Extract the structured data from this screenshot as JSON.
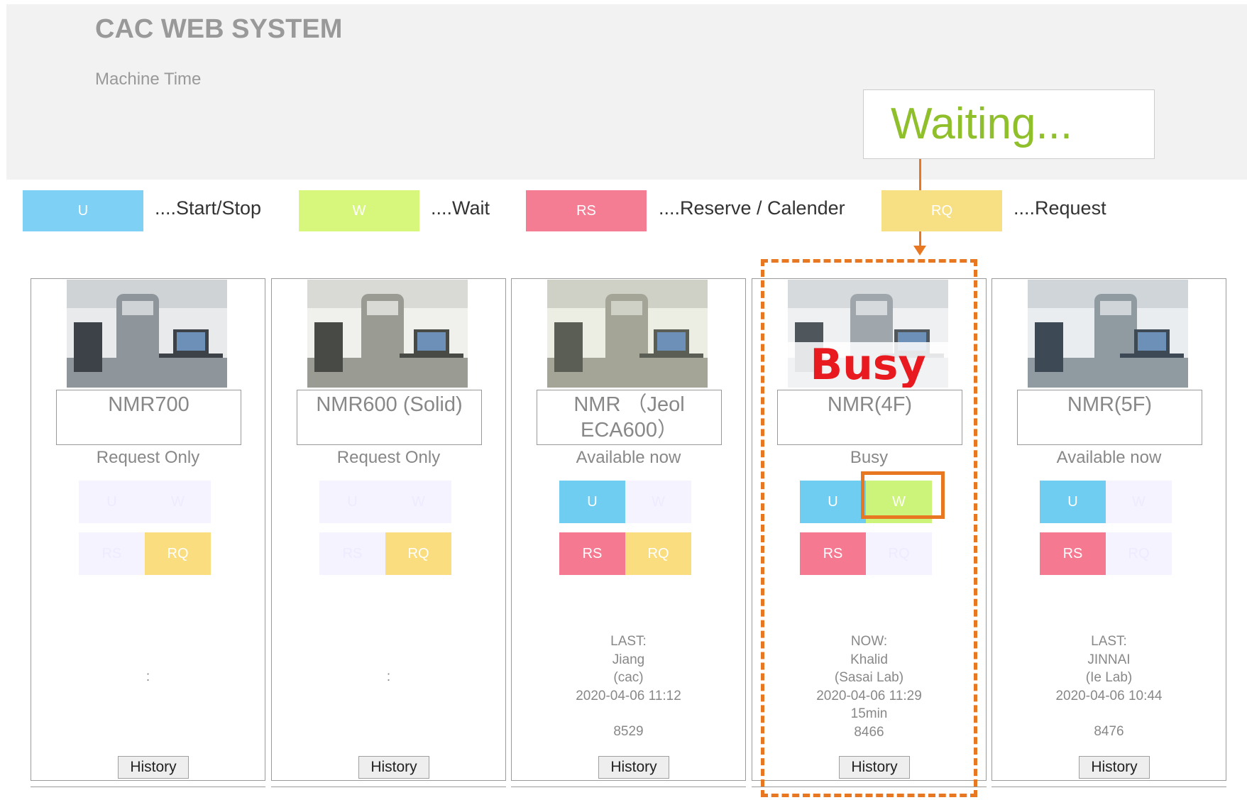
{
  "header": {
    "title": "CAC WEB SYSTEM",
    "subtitle": "Machine Time",
    "callout": "Waiting..."
  },
  "legend": [
    {
      "code": "U",
      "label": "....Start/Stop",
      "color": "#7ed0f4"
    },
    {
      "code": "W",
      "label": "....Wait",
      "color": "#d6f77c"
    },
    {
      "code": "RS",
      "label": "....Reserve / Calender",
      "color": "#f47c93"
    },
    {
      "code": "RQ",
      "label": "....Request",
      "color": "#f7df84"
    }
  ],
  "colors": {
    "u": "#6fcdf1",
    "w": "#ccf47a",
    "rs": "#f57a91",
    "rq": "#f9dd7e",
    "inactive": "#f5f3ff",
    "highlight": "#e87722"
  },
  "buttons": {
    "u": "U",
    "w": "W",
    "rs": "RS",
    "rq": "RQ"
  },
  "history_label": "History",
  "machines": [
    {
      "name": "NMR700",
      "status": "Request Only",
      "active": {
        "u": false,
        "w": false,
        "rs": false,
        "rq": true
      },
      "info": [
        "",
        "",
        ":",
        "",
        "",
        ""
      ]
    },
    {
      "name": "NMR600 (Solid)",
      "status": "Request Only",
      "active": {
        "u": false,
        "w": false,
        "rs": false,
        "rq": true
      },
      "info": [
        "",
        "",
        ":",
        "",
        "",
        ""
      ]
    },
    {
      "name": "NMR （Jeol ECA600）",
      "status": "Available now",
      "active": {
        "u": true,
        "w": false,
        "rs": true,
        "rq": true
      },
      "info": [
        "LAST:",
        "Jiang",
        "(cac)",
        "2020-04-06 11:12",
        "",
        "8529"
      ]
    },
    {
      "name": "NMR(4F)",
      "status": "Busy",
      "overlay": "Busy",
      "active": {
        "u": true,
        "w": true,
        "rs": true,
        "rq": false
      },
      "info": [
        "NOW:",
        "Khalid",
        "(Sasai Lab)",
        "2020-04-06 11:29",
        "15min",
        "8466"
      ]
    },
    {
      "name": "NMR(5F)",
      "status": "Available now",
      "active": {
        "u": true,
        "w": false,
        "rs": true,
        "rq": false
      },
      "info": [
        "LAST:",
        "JINNAI",
        "(Ie Lab)",
        "2020-04-06 10:44",
        "",
        "8476"
      ]
    }
  ]
}
